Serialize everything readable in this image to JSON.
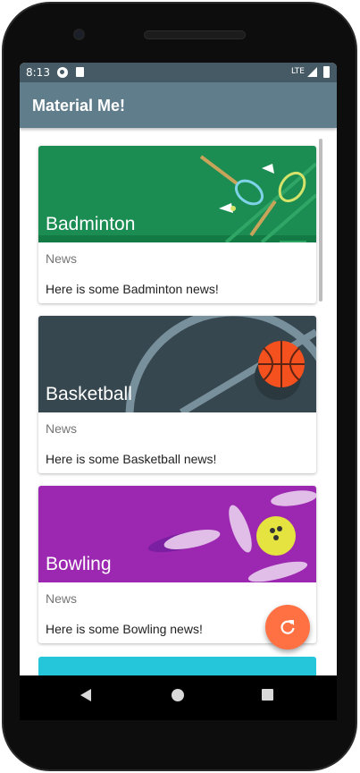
{
  "status_bar": {
    "time": "8:13",
    "network": "LTE",
    "icons": [
      "app-notification-icon",
      "sd-card-icon",
      "signal-icon",
      "battery-icon"
    ]
  },
  "app_bar": {
    "title": "Material Me!",
    "color": "#607d8b",
    "status_color": "#455a64"
  },
  "cards": [
    {
      "title": "Badminton",
      "subtitle": "News",
      "info": "Here is some Badminton news!",
      "image_color": "#1b8c52",
      "icon": "badminton-image"
    },
    {
      "title": "Basketball",
      "subtitle": "News",
      "info": "Here is some Basketball news!",
      "image_color": "#37474f",
      "icon": "basketball-image"
    },
    {
      "title": "Bowling",
      "subtitle": "News",
      "info": "Here is some Bowling news!",
      "image_color": "#9c27b0",
      "icon": "bowling-image"
    },
    {
      "image_color": "#26c6da"
    }
  ],
  "fab": {
    "icon": "refresh-icon",
    "color": "#ff7043"
  },
  "nav_bar": {
    "icons": [
      "back-icon",
      "home-icon",
      "recents-icon"
    ]
  }
}
